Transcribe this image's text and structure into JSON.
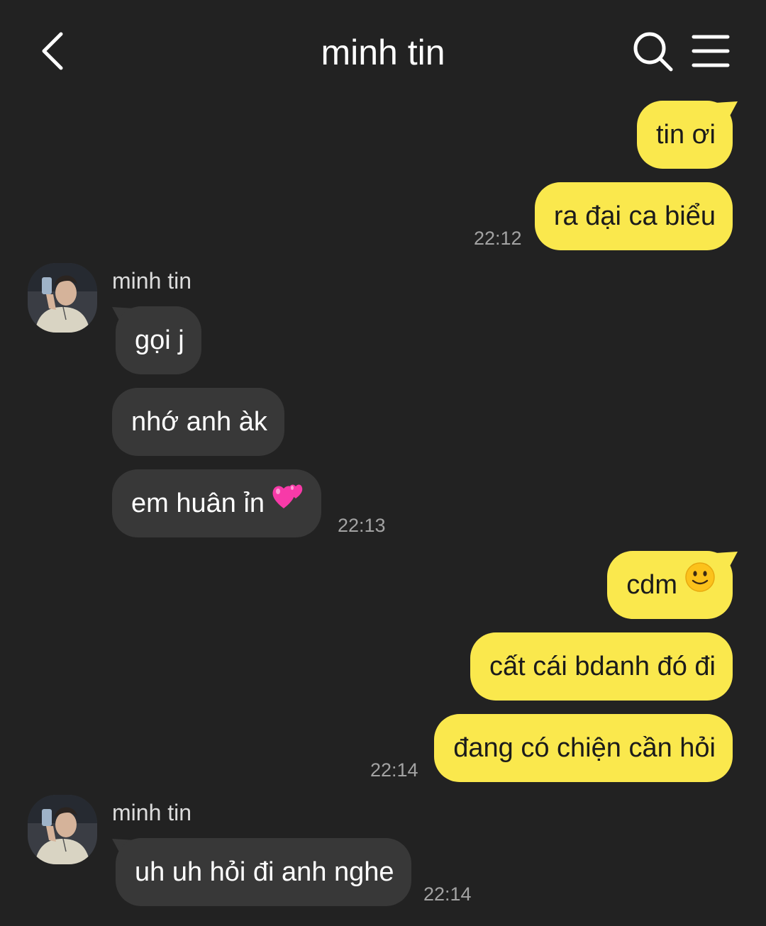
{
  "header": {
    "title": "minh tin",
    "back_icon": "chevron-left-icon",
    "search_icon": "search-icon",
    "menu_icon": "hamburger-menu-icon"
  },
  "colors": {
    "background": "#222222",
    "outgoing_bubble": "#fae84d",
    "incoming_bubble": "#383838",
    "timestamp": "#a3a3a3"
  },
  "messages": {
    "m1": {
      "text": "tin ơi"
    },
    "m2": {
      "text": "ra đại ca biểu",
      "time": "22:12"
    },
    "group1": {
      "sender": "minh tin"
    },
    "m3": {
      "text": "gọi j"
    },
    "m4": {
      "text": "nhớ anh àk"
    },
    "m5": {
      "text": "em huân ỉn",
      "emoji": "two-hearts-emoji",
      "time": "22:13"
    },
    "m6": {
      "text": "cdm",
      "emoji": "slightly-smiling-face-emoji"
    },
    "m7": {
      "text": "cất cái bdanh đó đi"
    },
    "m8": {
      "text": "đang có chiện cần hỏi",
      "time": "22:14"
    },
    "group2": {
      "sender": "minh tin"
    },
    "m9": {
      "text": "uh uh hỏi đi anh nghe",
      "time": "22:14"
    }
  }
}
